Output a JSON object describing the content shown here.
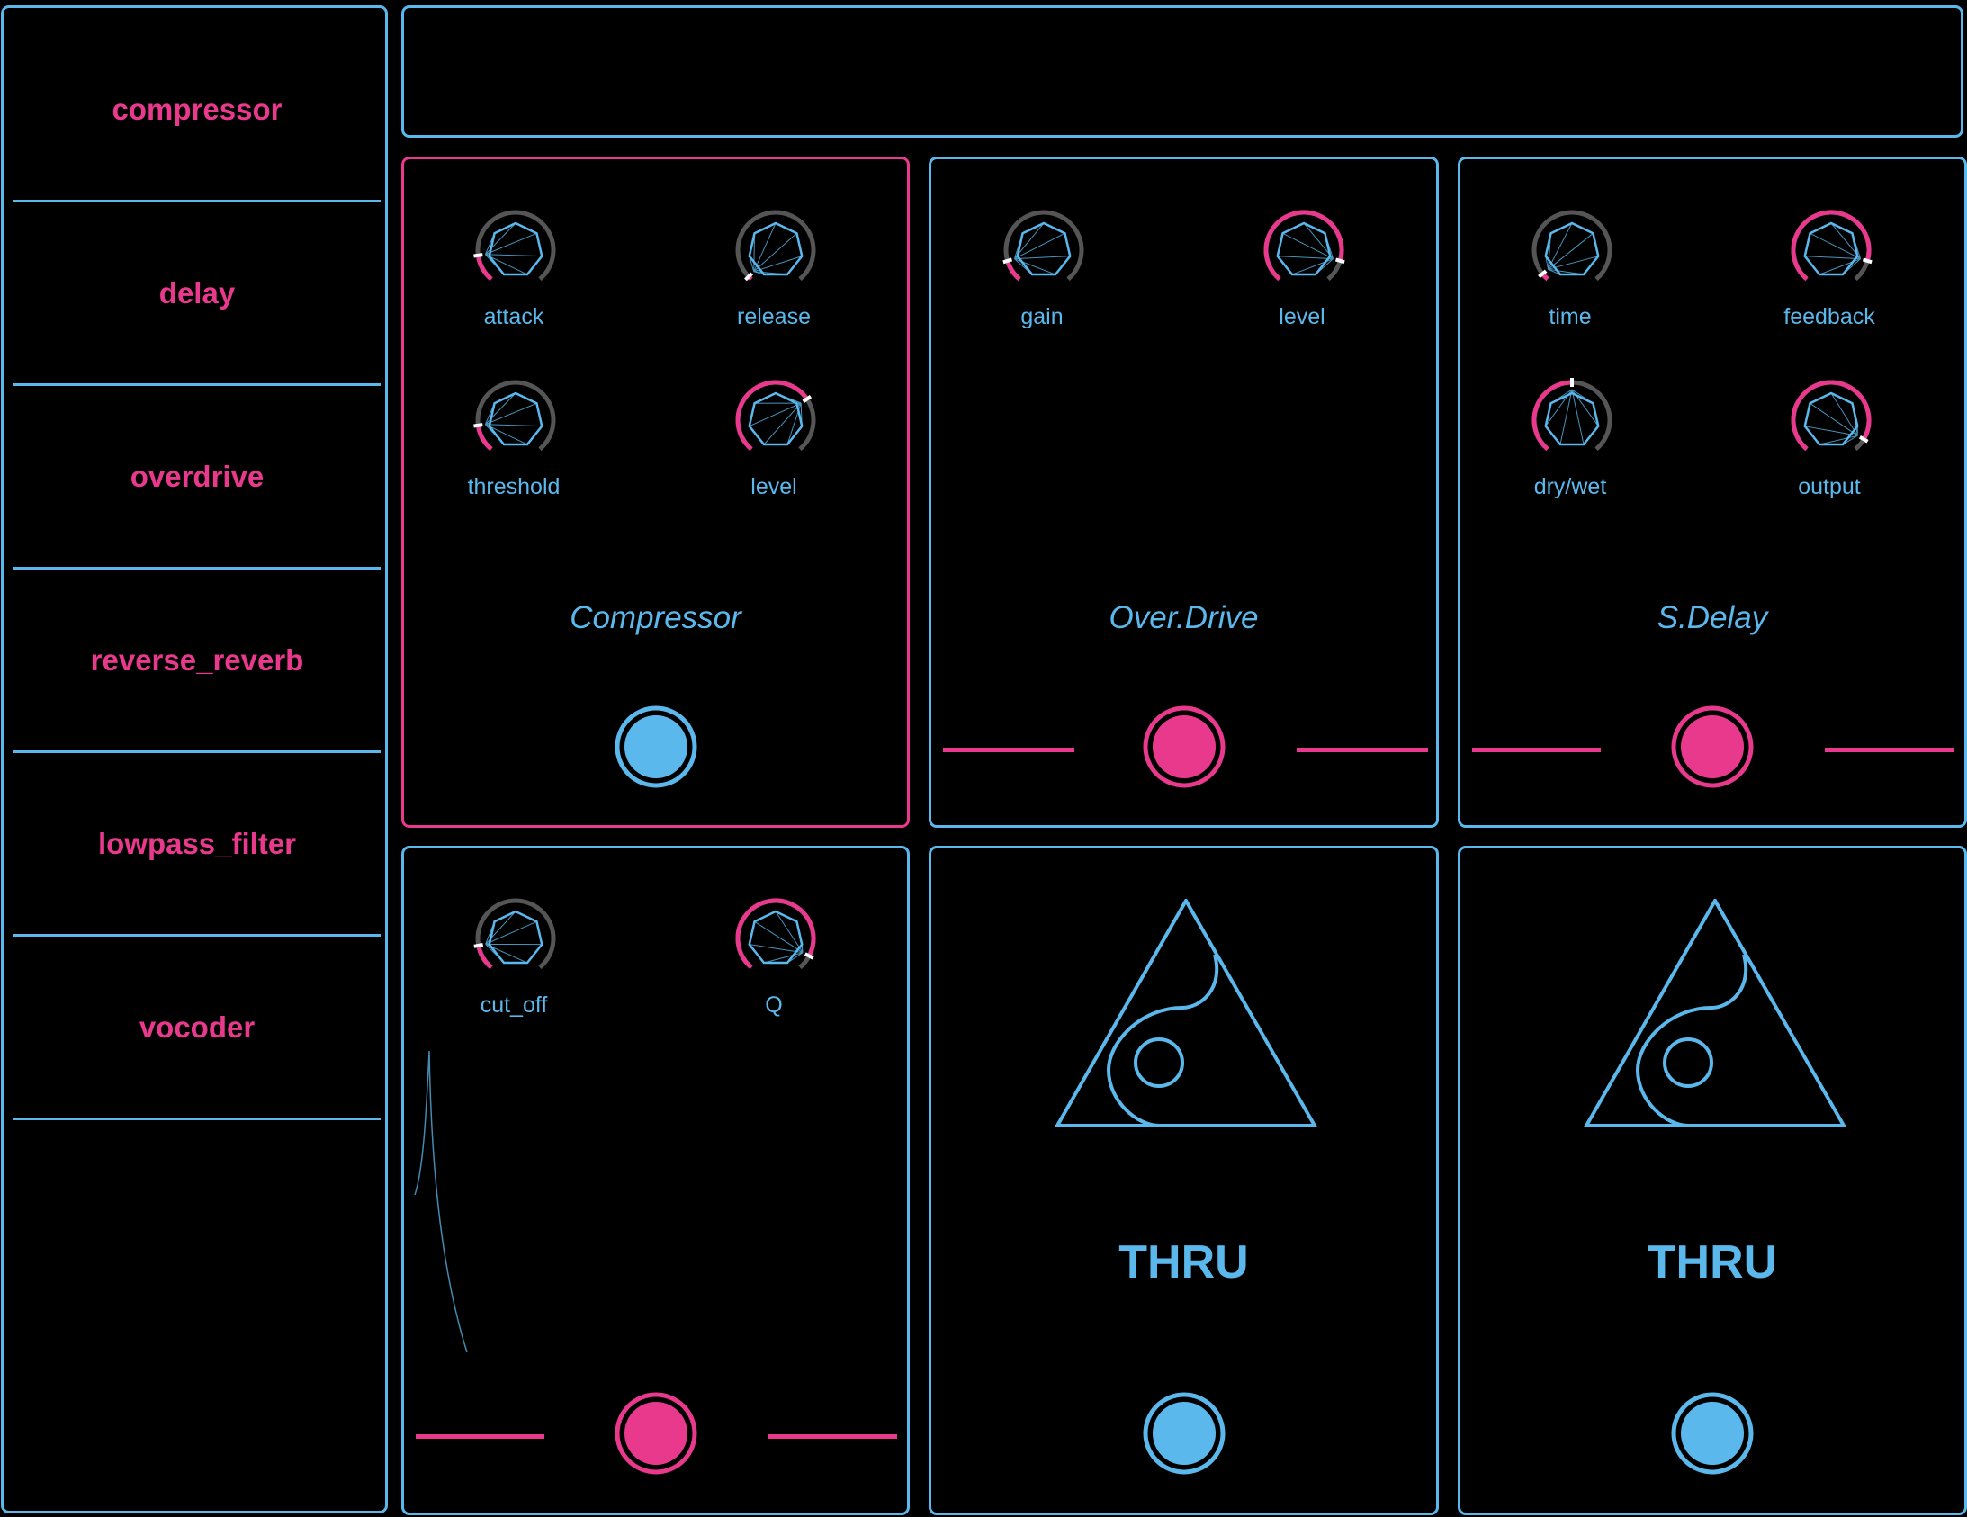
{
  "colors": {
    "accent_blue": "#5bb8ec",
    "accent_pink": "#e8398d",
    "knob_track": "#555555",
    "background": "#000000"
  },
  "sidebar": {
    "items": [
      {
        "label": "compressor"
      },
      {
        "label": "delay"
      },
      {
        "label": "overdrive"
      },
      {
        "label": "reverse_reverb"
      },
      {
        "label": "lowpass_filter"
      },
      {
        "label": "vocoder"
      }
    ]
  },
  "panels": {
    "compressor": {
      "title": "Compressor",
      "selected": true,
      "footswitch": "off",
      "knobs": [
        {
          "label": "attack",
          "value": 0.15
        },
        {
          "label": "release",
          "value": 0.02
        },
        {
          "label": "threshold",
          "value": 0.15
        },
        {
          "label": "level",
          "value": 0.7
        }
      ]
    },
    "overdrive": {
      "title": "Over.Drive",
      "footswitch": "on",
      "knobs": [
        {
          "label": "gain",
          "value": 0.12
        },
        {
          "label": "level",
          "value": 0.88
        }
      ]
    },
    "delay": {
      "title": "S.Delay",
      "footswitch": "on",
      "knobs": [
        {
          "label": "time",
          "value": 0.04
        },
        {
          "label": "feedback",
          "value": 0.88
        },
        {
          "label": "dry/wet",
          "value": 0.5
        },
        {
          "label": "output",
          "value": 0.93
        }
      ]
    },
    "filter": {
      "footswitch": "on",
      "knobs": [
        {
          "label": "cut_off",
          "value": 0.14
        },
        {
          "label": "Q",
          "value": 0.92
        }
      ]
    },
    "thru1": {
      "label": "THRU",
      "footswitch": "off",
      "icon": "triangle-logo-icon"
    },
    "thru2": {
      "label": "THRU",
      "footswitch": "off",
      "icon": "triangle-logo-icon"
    }
  }
}
